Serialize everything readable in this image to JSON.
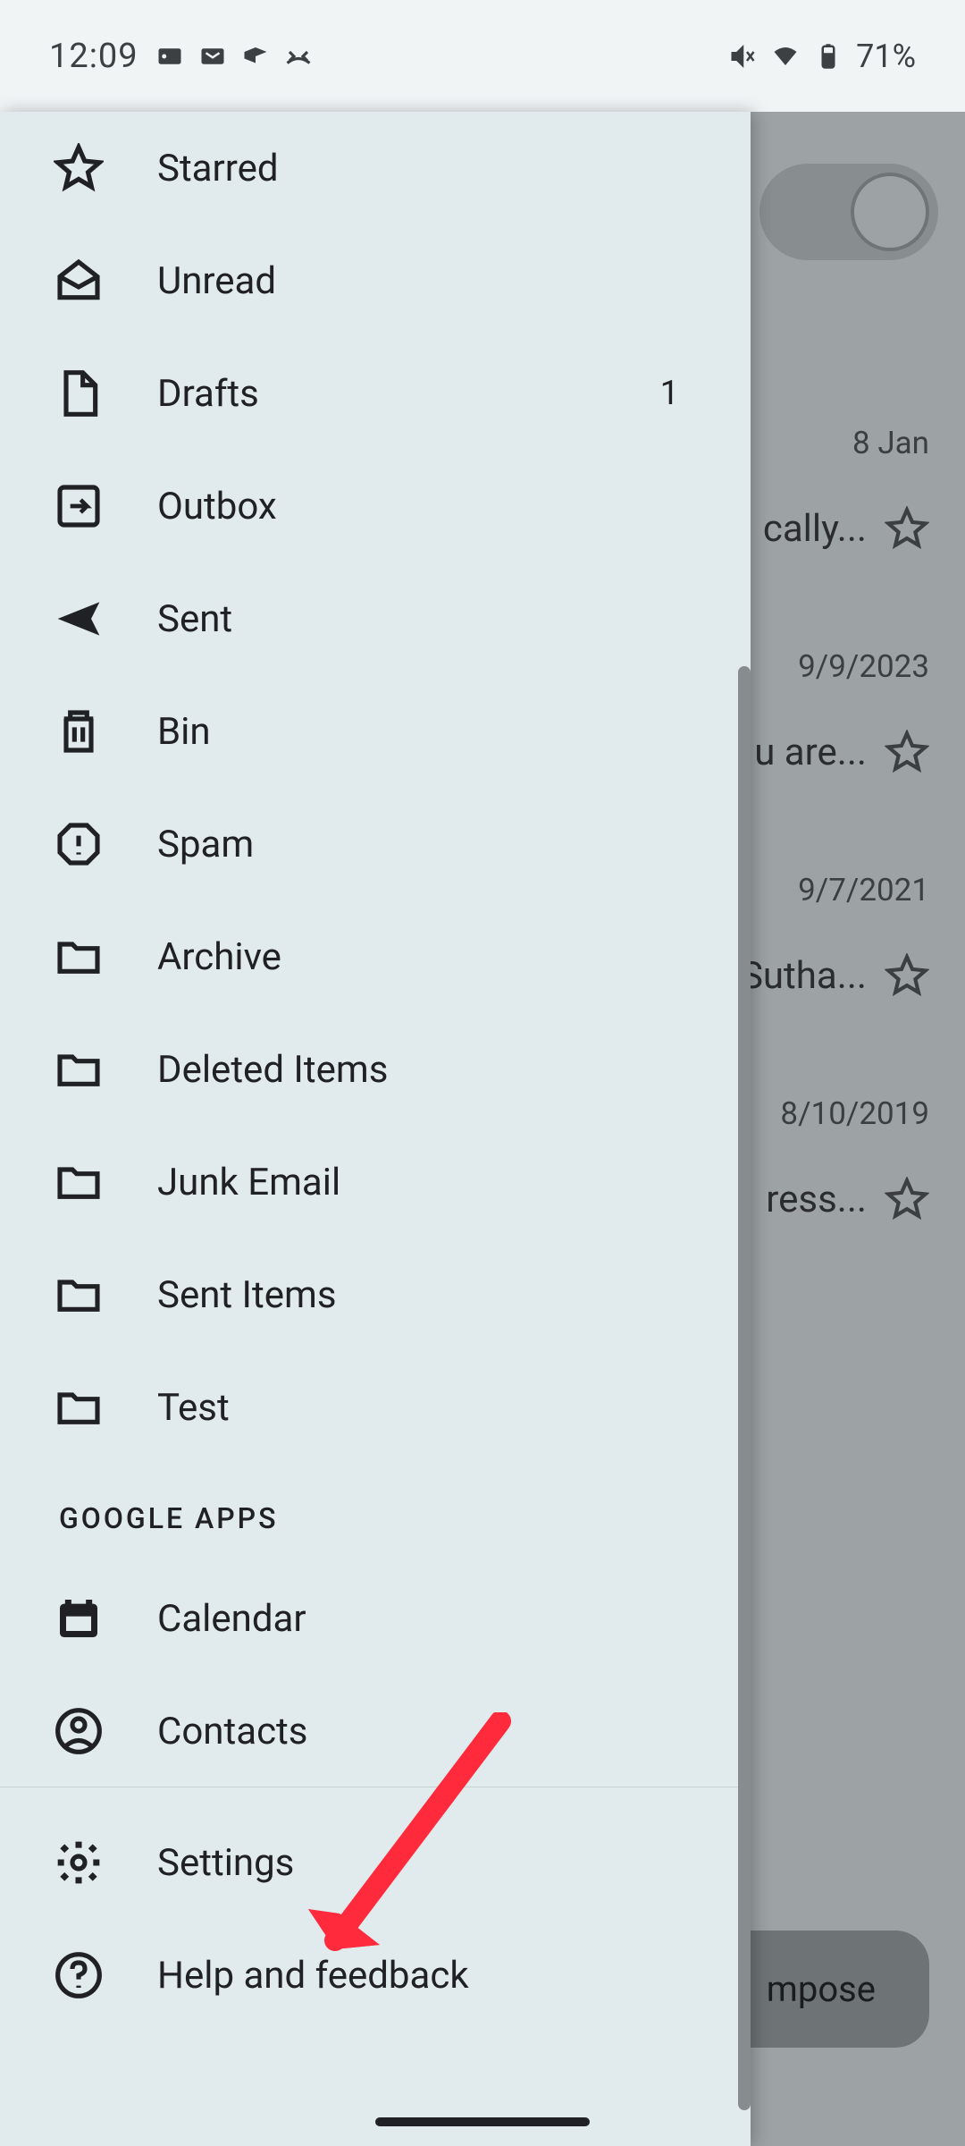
{
  "status": {
    "time": "12:09",
    "battery": "71%"
  },
  "drawer": {
    "items": [
      {
        "label": "Starred",
        "icon": "star-icon",
        "count": ""
      },
      {
        "label": "Unread",
        "icon": "mail-open-icon",
        "count": ""
      },
      {
        "label": "Drafts",
        "icon": "draft-icon",
        "count": "1"
      },
      {
        "label": "Outbox",
        "icon": "outbox-icon",
        "count": ""
      },
      {
        "label": "Sent",
        "icon": "send-icon",
        "count": ""
      },
      {
        "label": "Bin",
        "icon": "trash-icon",
        "count": ""
      },
      {
        "label": "Spam",
        "icon": "spam-icon",
        "count": ""
      },
      {
        "label": "Archive",
        "icon": "folder-icon",
        "count": ""
      },
      {
        "label": "Deleted Items",
        "icon": "folder-icon",
        "count": ""
      },
      {
        "label": "Junk Email",
        "icon": "folder-icon",
        "count": ""
      },
      {
        "label": "Sent Items",
        "icon": "folder-icon",
        "count": ""
      },
      {
        "label": "Test",
        "icon": "folder-icon",
        "count": ""
      }
    ],
    "section_header": "GOOGLE APPS",
    "apps": [
      {
        "label": "Calendar",
        "icon": "calendar-icon"
      },
      {
        "label": "Contacts",
        "icon": "contacts-icon"
      }
    ],
    "footer": [
      {
        "label": "Settings",
        "icon": "settings-icon"
      },
      {
        "label": "Help and feedback",
        "icon": "help-icon"
      }
    ]
  },
  "bg": {
    "compose": "mpose",
    "rows": [
      {
        "date": "8 Jan",
        "snippet": "cally..."
      },
      {
        "date": "9/9/2023",
        "snippet": "u are..."
      },
      {
        "date": "9/7/2021",
        "snippet": "Sutha..."
      },
      {
        "date": "8/10/2019",
        "snippet": "ress..."
      }
    ]
  }
}
